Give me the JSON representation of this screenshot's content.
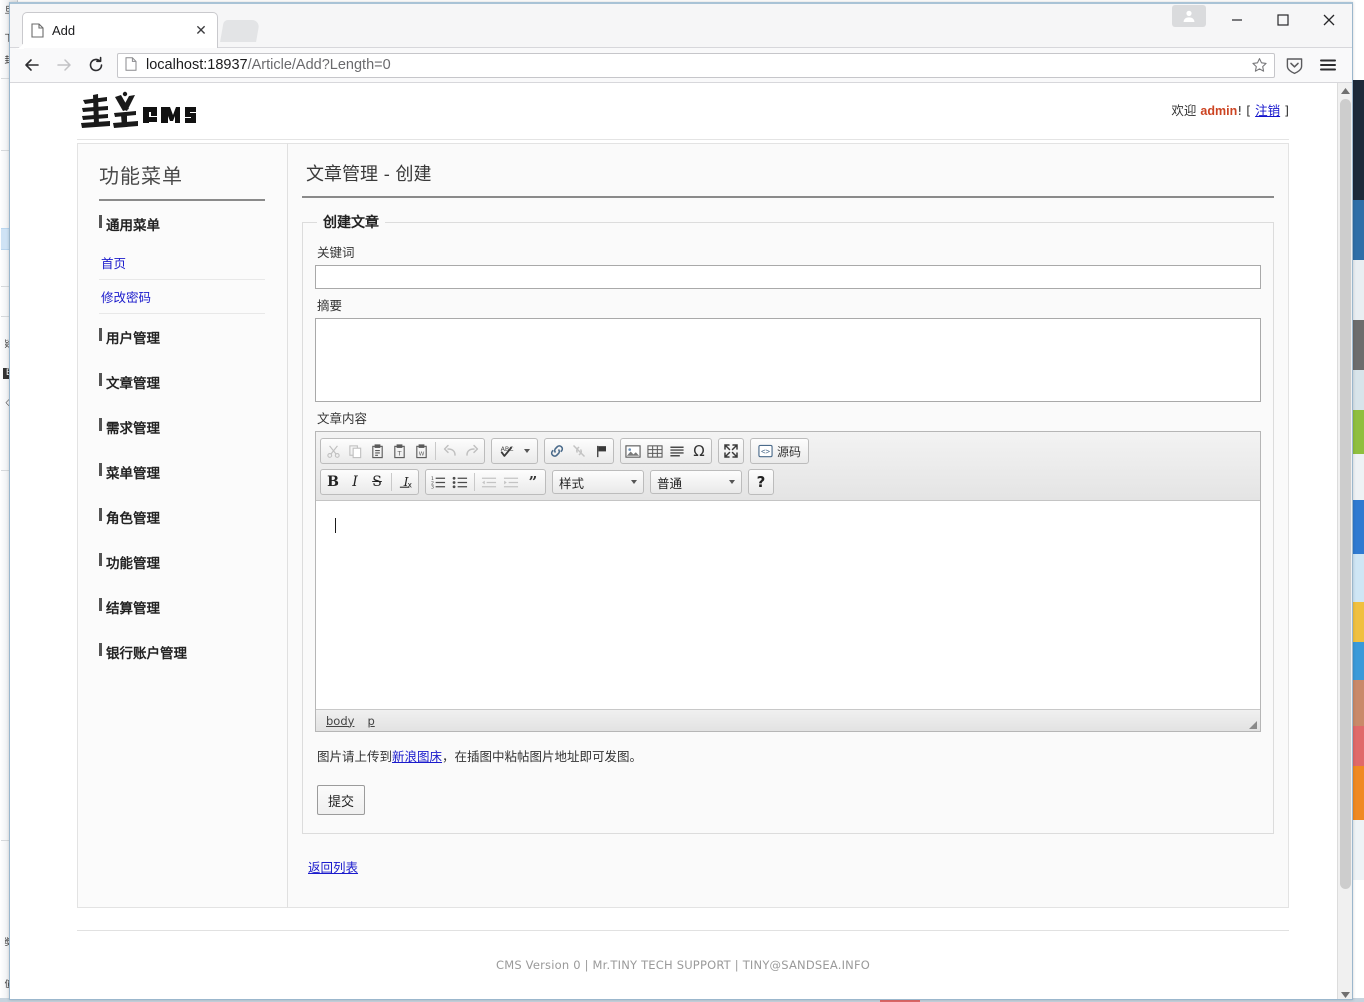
{
  "browser": {
    "tab": {
      "title": "Add",
      "favicon_icon": "document-icon",
      "close_icon": "close-icon"
    },
    "new_tab_icon": "new-tab-icon",
    "window_controls": {
      "account_icon": "account-person-icon",
      "minimize_icon": "minimize-icon",
      "maximize_icon": "maximize-icon",
      "close_icon": "window-close-icon"
    },
    "nav": {
      "back_icon": "back-arrow-icon",
      "forward_icon": "forward-arrow-icon",
      "reload_icon": "reload-icon",
      "page_icon": "page-identity-icon",
      "bookmark_icon": "star-icon",
      "pocket_icon": "shield-pocket-icon",
      "menu_icon": "hamburger-menu-icon"
    },
    "url": {
      "host": "localhost:18937",
      "path": "/Article/Add?Length=0",
      "full": "localhost:18937/Article/Add?Length=0"
    }
  },
  "site": {
    "logo_text": "真文CMS",
    "welcome_prefix": "欢迎",
    "welcome_user": "admin",
    "welcome_suffix": "!",
    "bracket_open": "[",
    "logout_label": "注销",
    "bracket_close": "]"
  },
  "sidebar": {
    "title": "功能菜单",
    "groups": [
      {
        "title": "通用菜单",
        "links": [
          {
            "label": "首页"
          },
          {
            "label": "修改密码"
          }
        ]
      },
      {
        "title": "用户管理",
        "links": []
      },
      {
        "title": "文章管理",
        "links": []
      },
      {
        "title": "需求管理",
        "links": []
      },
      {
        "title": "菜单管理",
        "links": []
      },
      {
        "title": "角色管理",
        "links": []
      },
      {
        "title": "功能管理",
        "links": []
      },
      {
        "title": "结算管理",
        "links": []
      },
      {
        "title": "银行账户管理",
        "links": []
      }
    ]
  },
  "content": {
    "page_title": "文章管理 - 创建",
    "card_legend": "创建文章",
    "fields": {
      "keywords_label": "关键词",
      "keywords_value": "",
      "summary_label": "摘要",
      "summary_value": "",
      "body_label": "文章内容",
      "body_value": ""
    },
    "hint": {
      "before": "图片请上传到",
      "link": "新浪图床",
      "after": "，在插图中粘帖图片地址即可发图。"
    },
    "submit_label": "提交",
    "back_link_label": "返回列表"
  },
  "editor": {
    "toolbar_row1": [
      {
        "name": "cut",
        "icon": "scissors-icon",
        "disabled": true
      },
      {
        "name": "copy",
        "icon": "copy-icon",
        "disabled": true
      },
      {
        "name": "paste",
        "icon": "clipboard-icon",
        "disabled": false
      },
      {
        "name": "paste-as-text",
        "icon": "clipboard-text-icon",
        "disabled": false
      },
      {
        "name": "paste-from-word",
        "icon": "clipboard-word-icon",
        "disabled": false
      },
      {
        "name": "undo",
        "icon": "undo-arrow-icon",
        "disabled": true
      },
      {
        "name": "redo",
        "icon": "redo-arrow-icon",
        "disabled": true
      },
      {
        "name": "spellcheck",
        "icon": "abc-check-icon",
        "disabled": false
      },
      {
        "name": "link",
        "icon": "chain-link-icon",
        "disabled": false
      },
      {
        "name": "unlink",
        "icon": "broken-link-icon",
        "disabled": true
      },
      {
        "name": "anchor",
        "icon": "flag-icon",
        "disabled": false
      },
      {
        "name": "image",
        "icon": "picture-icon",
        "disabled": false
      },
      {
        "name": "table",
        "icon": "table-grid-icon",
        "disabled": false
      },
      {
        "name": "horizontal-rule",
        "icon": "horizontal-lines-icon",
        "disabled": false
      },
      {
        "name": "special-char",
        "icon": "omega-icon",
        "disabled": false
      },
      {
        "name": "maximize",
        "icon": "expand-arrows-icon",
        "disabled": false
      },
      {
        "name": "source",
        "icon": "source-code-icon",
        "label": "源码",
        "disabled": false
      }
    ],
    "toolbar_row2": [
      {
        "name": "bold",
        "icon": "bold-icon",
        "label": "B",
        "disabled": false
      },
      {
        "name": "italic",
        "icon": "italic-icon",
        "label": "I",
        "disabled": false
      },
      {
        "name": "strike",
        "icon": "strikethrough-icon",
        "label": "S",
        "disabled": false
      },
      {
        "name": "remove-format",
        "icon": "remove-format-icon",
        "disabled": false
      },
      {
        "name": "numbered-list",
        "icon": "numbered-list-icon",
        "disabled": false
      },
      {
        "name": "bulleted-list",
        "icon": "bulleted-list-icon",
        "disabled": false
      },
      {
        "name": "outdent",
        "icon": "outdent-icon",
        "disabled": true
      },
      {
        "name": "indent",
        "icon": "indent-icon",
        "disabled": true
      },
      {
        "name": "blockquote",
        "icon": "quote-icon",
        "disabled": false
      },
      {
        "name": "help",
        "icon": "question-mark-icon",
        "label": "?",
        "disabled": false
      }
    ],
    "styles_combo_label": "样式",
    "format_combo_label": "普通",
    "elements_path": [
      "body",
      "p"
    ]
  },
  "footer": {
    "text": "CMS Version 0  |  Mr.TINY TECH SUPPORT  |  TINY@SANDSEA.INFO"
  },
  "colors": {
    "link": "#1a1acc",
    "accent_user": "#cc4422",
    "rule": "#8a8a8a",
    "panel_bg": "#fafafa",
    "border": "#e3e3e3"
  }
}
